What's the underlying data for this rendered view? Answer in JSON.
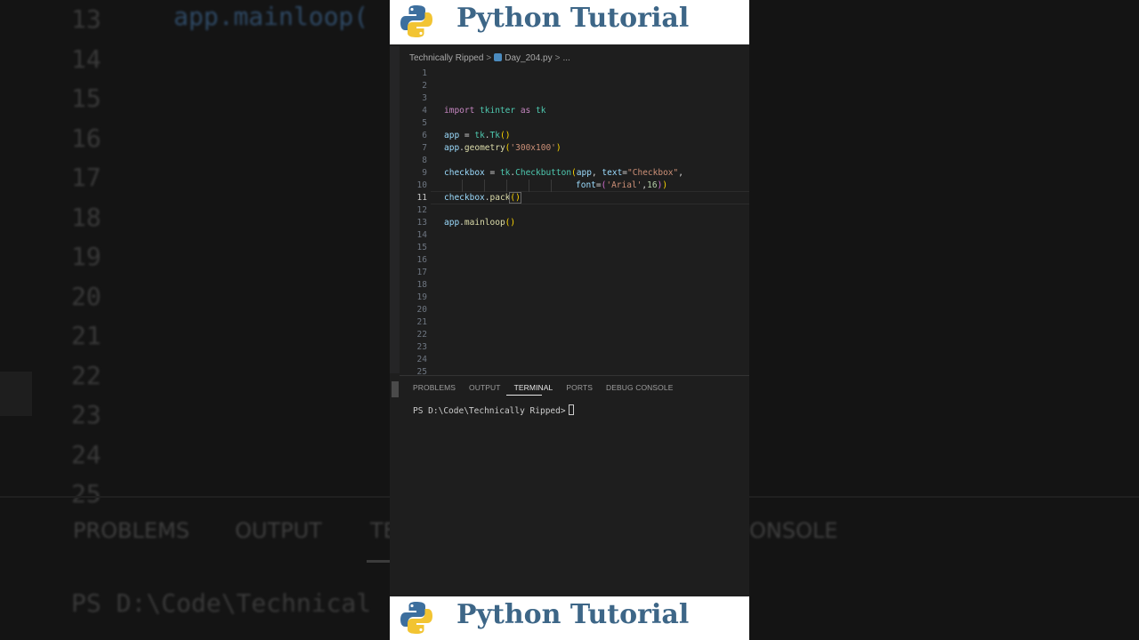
{
  "banner": {
    "title": "Python Tutorial"
  },
  "breadcrumb": {
    "folder": "Technically Ripped",
    "file": "Day_204.py",
    "more": "..."
  },
  "editor": {
    "line_numbers": [
      "1",
      "2",
      "3",
      "4",
      "5",
      "6",
      "7",
      "8",
      "9",
      "10",
      "11",
      "12",
      "13",
      "14",
      "15",
      "16",
      "17",
      "18",
      "19",
      "20",
      "21",
      "22",
      "23",
      "24",
      "25"
    ],
    "active_line": "11",
    "code": {
      "l4": {
        "a": "import",
        "b": " tkinter ",
        "c": "as",
        "d": " tk"
      },
      "l6": {
        "a": "app",
        "b": " = ",
        "c": "tk",
        "d": ".",
        "e": "Tk",
        "f": "()"
      },
      "l7": {
        "a": "app",
        "b": ".",
        "c": "geometry",
        "d": "(",
        "e": "'300x100'",
        "f": ")"
      },
      "l9": {
        "a": "checkbox",
        "b": " = ",
        "c": "tk",
        "d": ".",
        "e": "Checkbutton",
        "f": "(",
        "g": "app",
        "h": ", ",
        "i": "text",
        "j": "=",
        "k": "\"Checkbox\"",
        "l": ","
      },
      "l10": {
        "a": "font",
        "b": "=",
        "c": "(",
        "d": "'Arial'",
        "e": ",",
        "f": "16",
        "g": ")",
        "h": ")"
      },
      "l11": {
        "a": "checkbox",
        "b": ".",
        "c": "pack",
        "d": "()"
      },
      "l13": {
        "a": "app",
        "b": ".",
        "c": "mainloop",
        "d": "()"
      }
    }
  },
  "panel": {
    "tabs": [
      "PROBLEMS",
      "OUTPUT",
      "TERMINAL",
      "PORTS",
      "DEBUG CONSOLE"
    ],
    "active_tab": "TERMINAL",
    "terminal_prompt": "PS D:\\Code\\Technically Ripped>"
  },
  "background": {
    "line_numbers": [
      "13",
      "14",
      "15",
      "16",
      "17",
      "18",
      "19",
      "20",
      "21",
      "22",
      "23",
      "24",
      "25"
    ],
    "code_line": "app.mainloop(",
    "tab_problems": "PROBLEMS",
    "tab_output": "OUTPUT",
    "tab_terminal_partial": "TE",
    "tab_console_partial": "ONSOLE",
    "terminal_partial": "PS D:\\Code\\Technical"
  },
  "icons": [
    "python-logo-icon",
    "python-file-icon",
    "chevron-right-icon"
  ],
  "colors": {
    "banner_text": "#3d6687",
    "editor_bg": "#1e1e1e",
    "keyword": "#c586c0",
    "variable": "#9cdcfe",
    "class": "#4ec9b0",
    "function": "#dcdcaa",
    "string": "#ce9178"
  }
}
